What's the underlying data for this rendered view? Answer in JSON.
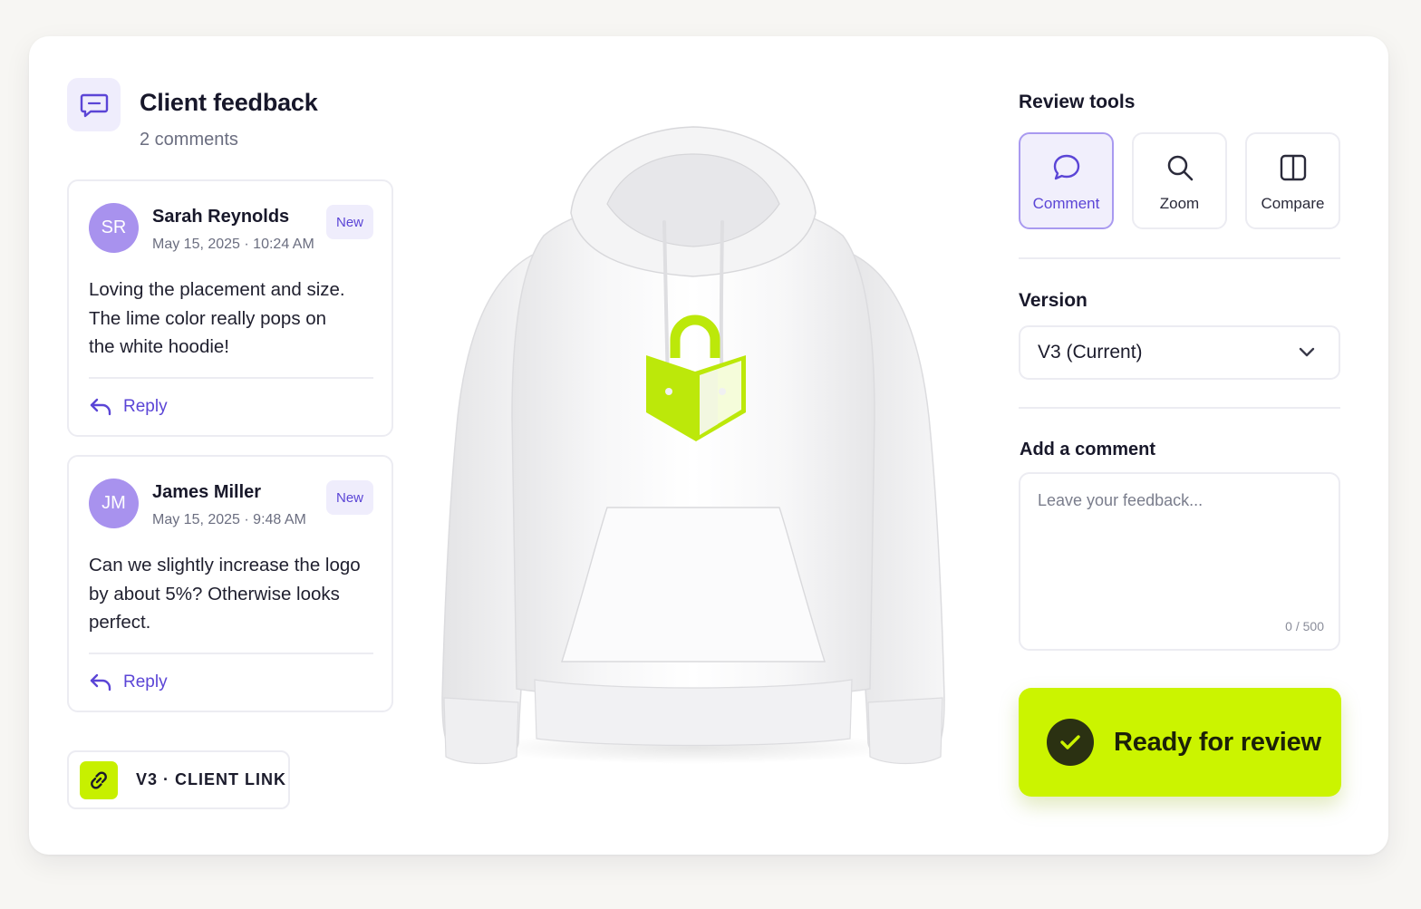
{
  "header": {
    "title": "Client feedback",
    "subtitle": "2 comments"
  },
  "comments": [
    {
      "initials": "SR",
      "author": "Sarah Reynolds",
      "date": "May 15, 2025 · 10:24 AM",
      "badge": "New",
      "lines": [
        "Loving the placement and size.",
        "The lime color really pops on",
        "the white hoodie!"
      ],
      "reply_label": "Reply"
    },
    {
      "initials": "JM",
      "author": "James Miller",
      "date": "May 15, 2025 · 9:48 AM",
      "badge": "New",
      "lines": [
        "Can we slightly increase the logo",
        "by about 5%? Otherwise looks",
        "perfect."
      ],
      "reply_label": "Reply"
    }
  ],
  "client_link": {
    "label": "V3 · CLIENT LINK",
    "icon": "link-icon"
  },
  "review_tools": {
    "title": "Review tools",
    "tools": [
      {
        "label": "Comment",
        "icon": "speech-bubble-icon",
        "active": true
      },
      {
        "label": "Zoom",
        "icon": "magnifier-icon",
        "active": false
      },
      {
        "label": "Compare",
        "icon": "split-view-icon",
        "active": false
      }
    ]
  },
  "version": {
    "title": "Version",
    "selected": "V3 (Current)"
  },
  "add_comment": {
    "title": "Add a comment",
    "placeholder": "Leave your feedback...",
    "counter": "0 / 500"
  },
  "ready_button": {
    "label": "Ready for review"
  },
  "colors": {
    "accent": "#5b45d6",
    "lime": "#cbf400",
    "avatar": "#a892ee",
    "badge_bg": "#efedfc"
  }
}
